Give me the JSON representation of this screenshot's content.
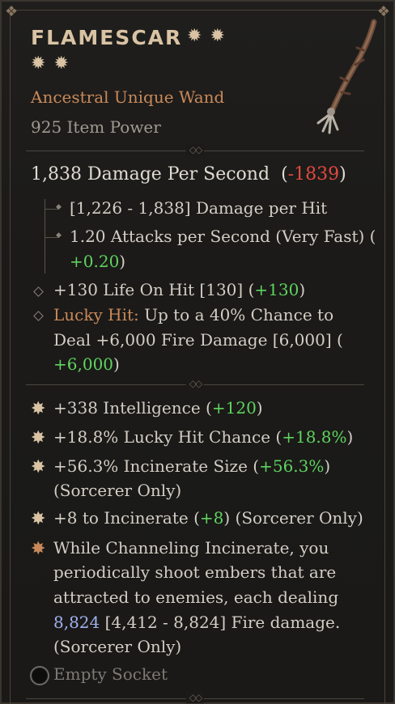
{
  "item": {
    "name": "FLAMESCAR",
    "type": "Ancestral Unique Wand",
    "item_power": "925 Item Power"
  },
  "dps": {
    "value": "1,838 Damage Per Second",
    "open": "(",
    "delta": "-1839",
    "close": ")"
  },
  "sub_stats": [
    {
      "text": "[1,226 - 1,838] Damage per Hit"
    },
    {
      "text_line1": "1.20 Attacks per Second (Very Fast) (",
      "delta": "+0.20",
      "close": ")"
    }
  ],
  "implicits": [
    {
      "text": "+130 Life On Hit [130] (",
      "delta": "+130",
      "close": ")"
    },
    {
      "label": "Lucky Hit:",
      "text1": " Up to a 40% Chance to",
      "text2": "Deal +6,000 Fire Damage [6,000] (",
      "delta": "+6,000",
      "close": ")"
    }
  ],
  "affixes": [
    {
      "text": "+338 Intelligence (",
      "delta": "+120",
      "close": ")"
    },
    {
      "text": "+18.8% Lucky Hit Chance (",
      "delta": "+18.8%",
      "close": ")"
    },
    {
      "text": "+56.3% Incinerate Size (",
      "delta": "+56.3%",
      "close": ")",
      "line2": "(Sorcerer Only)"
    },
    {
      "text": "+8 to Incinerate (",
      "delta": "+8",
      "close": ") (Sorcerer Only)"
    }
  ],
  "unique": {
    "part1": "While Channeling ",
    "skill": "Incinerate",
    "part2": ", you",
    "line2": "periodically shoot embers that are",
    "line3": "attracted to enemies, each dealing",
    "value": "8,824",
    "range": " [4,412 - 8,824] Fire damage.",
    "line5": "(Sorcerer Only)"
  },
  "socket": {
    "label": "Empty Socket"
  },
  "colors": {
    "name": "#d9c3a4",
    "unique_orange": "#c8895a",
    "positive": "#5fd35f",
    "negative": "#e0493f",
    "highlight_value": "#9fb1ee"
  },
  "icons": [
    "star-icon",
    "sparkle-bullet-icon",
    "diamond-bullet-icon",
    "socket-icon",
    "wand-image"
  ]
}
